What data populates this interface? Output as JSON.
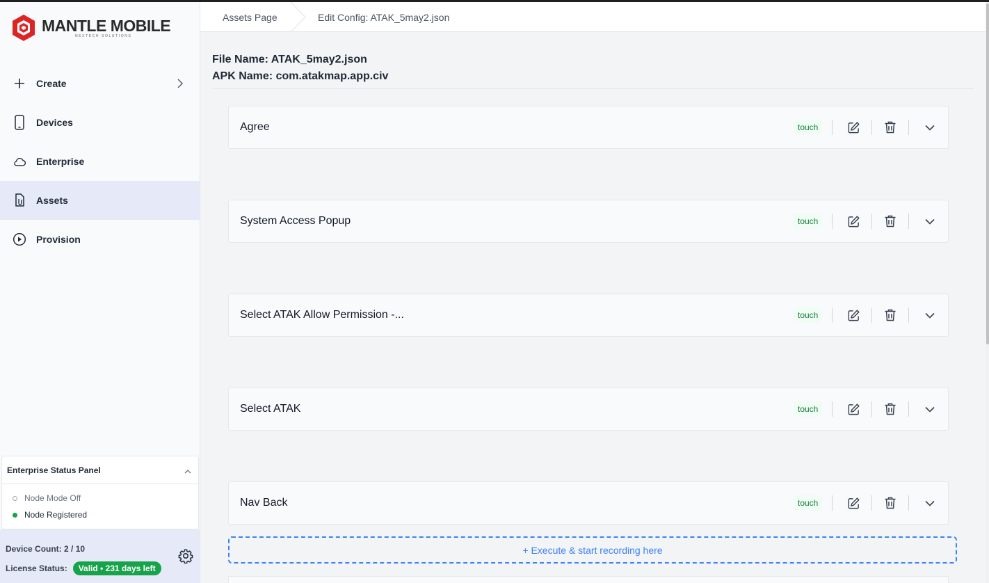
{
  "brand": {
    "name": "MANTLE MOBILE",
    "tagline": "NEXTECH SOLUTIONS",
    "accent_color": "#dc2626"
  },
  "sidebar": {
    "items": [
      {
        "label": "Create",
        "icon": "plus-icon",
        "has_submenu": true
      },
      {
        "label": "Devices",
        "icon": "smartphone-icon"
      },
      {
        "label": "Enterprise",
        "icon": "cloud-icon"
      },
      {
        "label": "Assets",
        "icon": "file-icon",
        "active": true
      },
      {
        "label": "Provision",
        "icon": "play-circle-icon"
      }
    ]
  },
  "status_panel": {
    "title": "Enterprise Status Panel",
    "node_mode": "Node Mode Off",
    "node_registered": "Node Registered"
  },
  "device_panel": {
    "device_count": "Device Count: 2 / 10",
    "license_label": "License Status:",
    "license_badge": "Valid • 231 days left",
    "badge_color": "#16a34a"
  },
  "breadcrumb": {
    "items": [
      "Assets Page",
      "Edit Config: ATAK_5may2.json"
    ]
  },
  "file": {
    "file_name": "File Name: ATAK_5may2.json",
    "apk_name": "APK Name: com.atakmap.app.civ"
  },
  "steps": [
    {
      "title": "Agree",
      "type": "touch"
    },
    {
      "title": "System Access Popup",
      "type": "touch"
    },
    {
      "title": "Select ATAK Allow Permission -...",
      "type": "touch"
    },
    {
      "title": "Select ATAK",
      "type": "touch"
    },
    {
      "title": "Nav Back",
      "type": "touch"
    }
  ],
  "record_button": "+ Execute & start recording here"
}
